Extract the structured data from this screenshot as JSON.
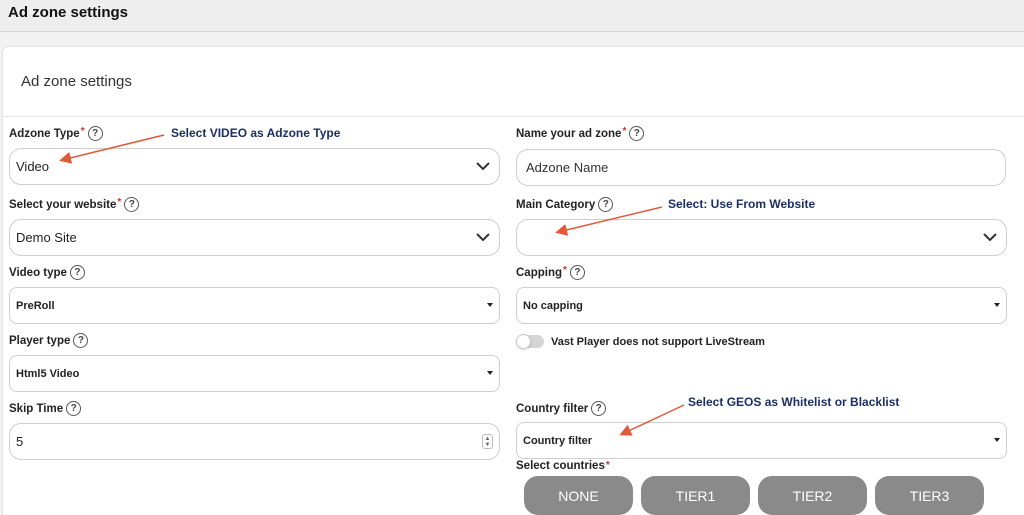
{
  "topbar": {
    "title": "Ad zone settings"
  },
  "card": {
    "title": "Ad zone settings"
  },
  "left": {
    "adzone_type": {
      "label": "Adzone Type",
      "value": "Video"
    },
    "website": {
      "label": "Select your website",
      "value": "Demo Site"
    },
    "video_type": {
      "label": "Video type",
      "value": "PreRoll"
    },
    "player_type": {
      "label": "Player type",
      "value": "Html5 Video"
    },
    "skip_time": {
      "label": "Skip Time",
      "value": "5"
    }
  },
  "right": {
    "zone_name": {
      "label": "Name your ad zone",
      "placeholder": "Adzone Name"
    },
    "main_category": {
      "label": "Main Category",
      "value": ""
    },
    "capping": {
      "label": "Capping",
      "value": "No capping"
    },
    "vast_toggle": {
      "label": "Vast Player does not support LiveStream",
      "on": false
    },
    "country_filter": {
      "label": "Country filter",
      "value": "Country filter"
    },
    "select_countries": {
      "label": "Select countries"
    }
  },
  "tiers": [
    "NONE",
    "TIER1",
    "TIER2",
    "TIER3"
  ],
  "annotations": {
    "adzone": "Select VIDEO as Adzone Type",
    "category": "Select: Use From Website",
    "geos": "Select GEOS as Whitelist or Blacklist"
  },
  "help_glyph": "?",
  "required_mark": "*",
  "colors": {
    "annotation_arrow": "#e05a3a",
    "annotation_text": "#1c2f63",
    "tier_button": "#8a8a8a",
    "required": "#d0312d"
  }
}
